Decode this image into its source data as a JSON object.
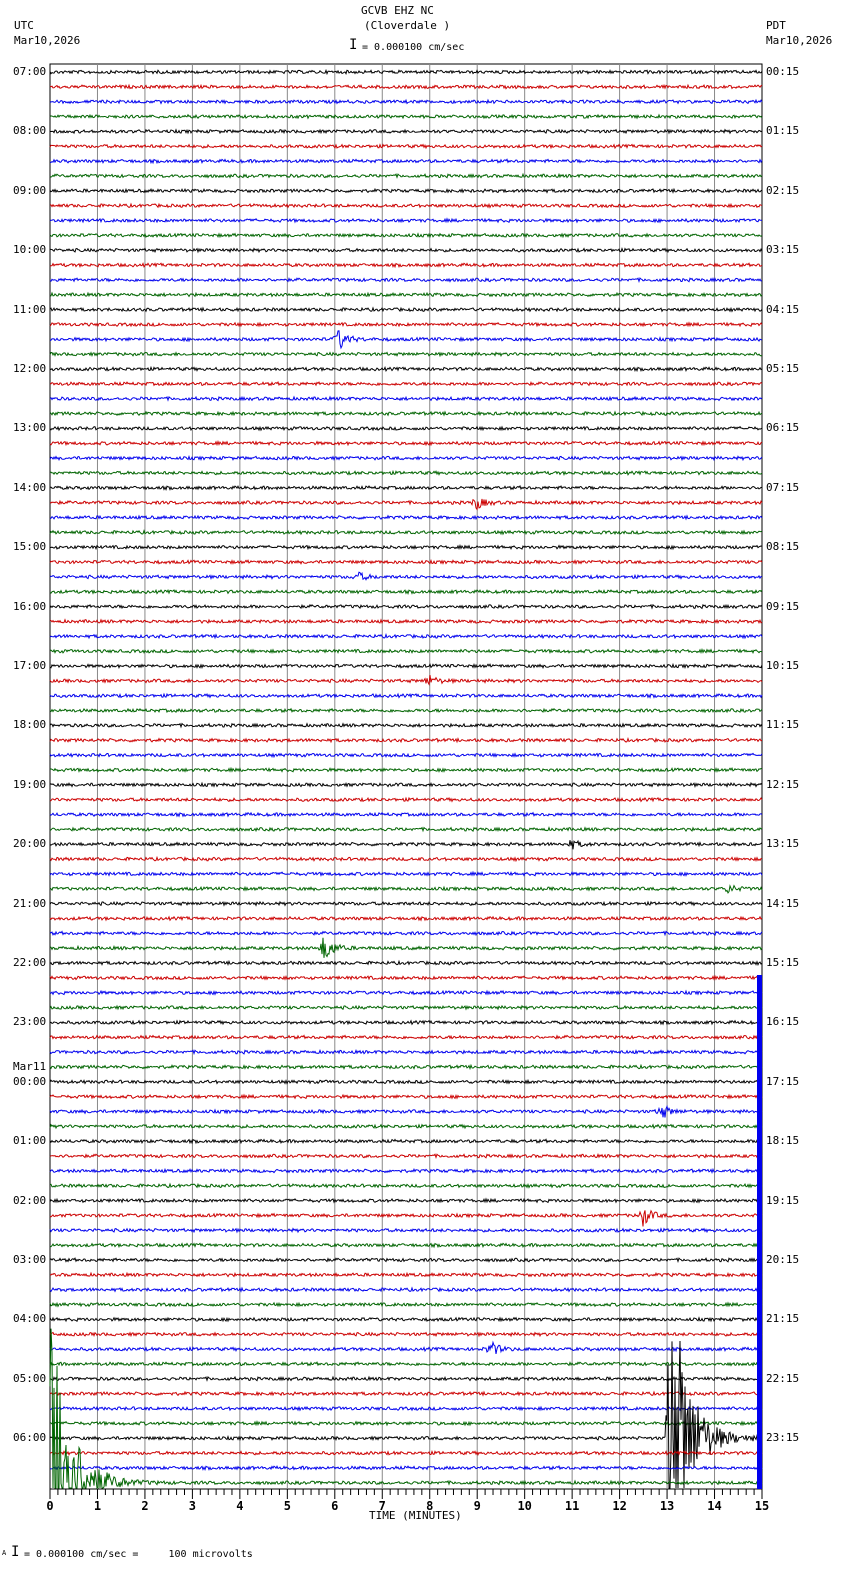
{
  "header": {
    "title": "GCVB EHZ NC",
    "subtitle": "(Cloverdale )",
    "scale_text": "= 0.000100 cm/sec",
    "left_tz": "UTC",
    "left_date": "Mar10,2026",
    "right_tz": "PDT",
    "right_date": "Mar10,2026"
  },
  "footer": {
    "scale_text": "= 0.000100 cm/sec =     100 microvolts",
    "marker": "A"
  },
  "chart_data": {
    "type": "line",
    "title": "GCVB EHZ NC (Cloverdale )",
    "xlabel": "TIME (MINUTES)",
    "xlim": [
      0,
      15
    ],
    "x_ticks": [
      "0",
      "1",
      "2",
      "3",
      "4",
      "5",
      "6",
      "7",
      "8",
      "9",
      "10",
      "11",
      "12",
      "13",
      "14",
      "15"
    ],
    "traces_per_hour": 4,
    "trace_colors": [
      "#000000",
      "#cc0000",
      "#0000ee",
      "#006400"
    ],
    "left_labels": [
      "07:00",
      "08:00",
      "09:00",
      "10:00",
      "11:00",
      "12:00",
      "13:00",
      "14:00",
      "15:00",
      "16:00",
      "17:00",
      "18:00",
      "19:00",
      "20:00",
      "21:00",
      "22:00",
      "23:00",
      "00:00",
      "01:00",
      "02:00",
      "03:00",
      "04:00",
      "05:00",
      "06:00"
    ],
    "date_change_label": {
      "hour_index": 17,
      "text": "Mar11"
    },
    "right_labels": [
      "00:15",
      "01:15",
      "02:15",
      "03:15",
      "04:15",
      "05:15",
      "06:15",
      "07:15",
      "08:15",
      "09:15",
      "10:15",
      "11:15",
      "12:15",
      "13:15",
      "14:15",
      "15:15",
      "16:15",
      "17:15",
      "18:15",
      "19:15",
      "20:15",
      "21:15",
      "22:15",
      "23:15"
    ],
    "events": [
      {
        "trace": 18,
        "minute": 6.1,
        "amplitude": 10
      },
      {
        "trace": 29,
        "minute": 9.0,
        "amplitude": 6
      },
      {
        "trace": 34,
        "minute": 6.5,
        "amplitude": 4
      },
      {
        "trace": 41,
        "minute": 8.0,
        "amplitude": 5
      },
      {
        "trace": 52,
        "minute": 11.0,
        "amplitude": 4
      },
      {
        "trace": 55,
        "minute": 14.3,
        "amplitude": 4
      },
      {
        "trace": 59,
        "minute": 5.8,
        "amplitude": 14
      },
      {
        "trace": 70,
        "minute": 12.9,
        "amplitude": 7
      },
      {
        "trace": 77,
        "minute": 12.5,
        "amplitude": 10
      },
      {
        "trace": 86,
        "minute": 9.3,
        "amplitude": 7
      },
      {
        "trace": 92,
        "minute": 13.1,
        "amplitude": 160
      },
      {
        "trace": 95,
        "minute": 0.05,
        "amplitude": 230
      }
    ]
  }
}
